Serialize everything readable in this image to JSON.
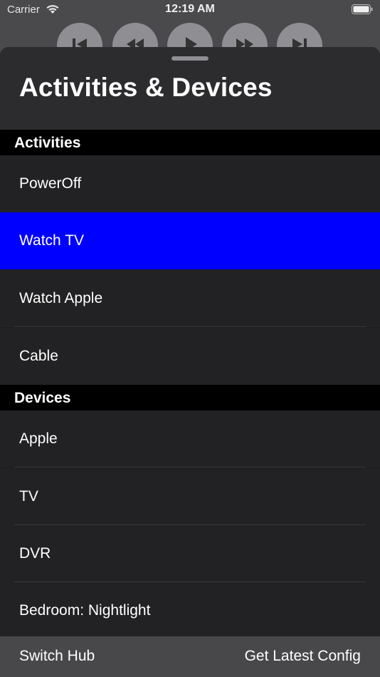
{
  "status_bar": {
    "carrier": "Carrier",
    "time": "12:19 AM"
  },
  "sheet": {
    "title": "Activities & Devices"
  },
  "sections": {
    "activities": {
      "header": "Activities",
      "items": [
        "PowerOff",
        "Watch TV",
        "Watch Apple",
        "Cable"
      ],
      "selected": "Watch TV"
    },
    "devices": {
      "header": "Devices",
      "items": [
        "Apple",
        "TV",
        "DVR",
        "Bedroom: Nightlight"
      ]
    }
  },
  "toolbar": {
    "left_label": "Switch Hub",
    "right_label": "Get Latest Config"
  },
  "colors": {
    "selection": "#0000ff",
    "sheet": "#1c1c1e",
    "header": "#2c2c2e",
    "section": "#000000",
    "toolbar": "#48484a"
  },
  "icons": [
    "wifi-icon",
    "battery-icon",
    "skip-back-icon",
    "rewind-icon",
    "play-icon",
    "fast-forward-icon",
    "skip-forward-icon"
  ]
}
